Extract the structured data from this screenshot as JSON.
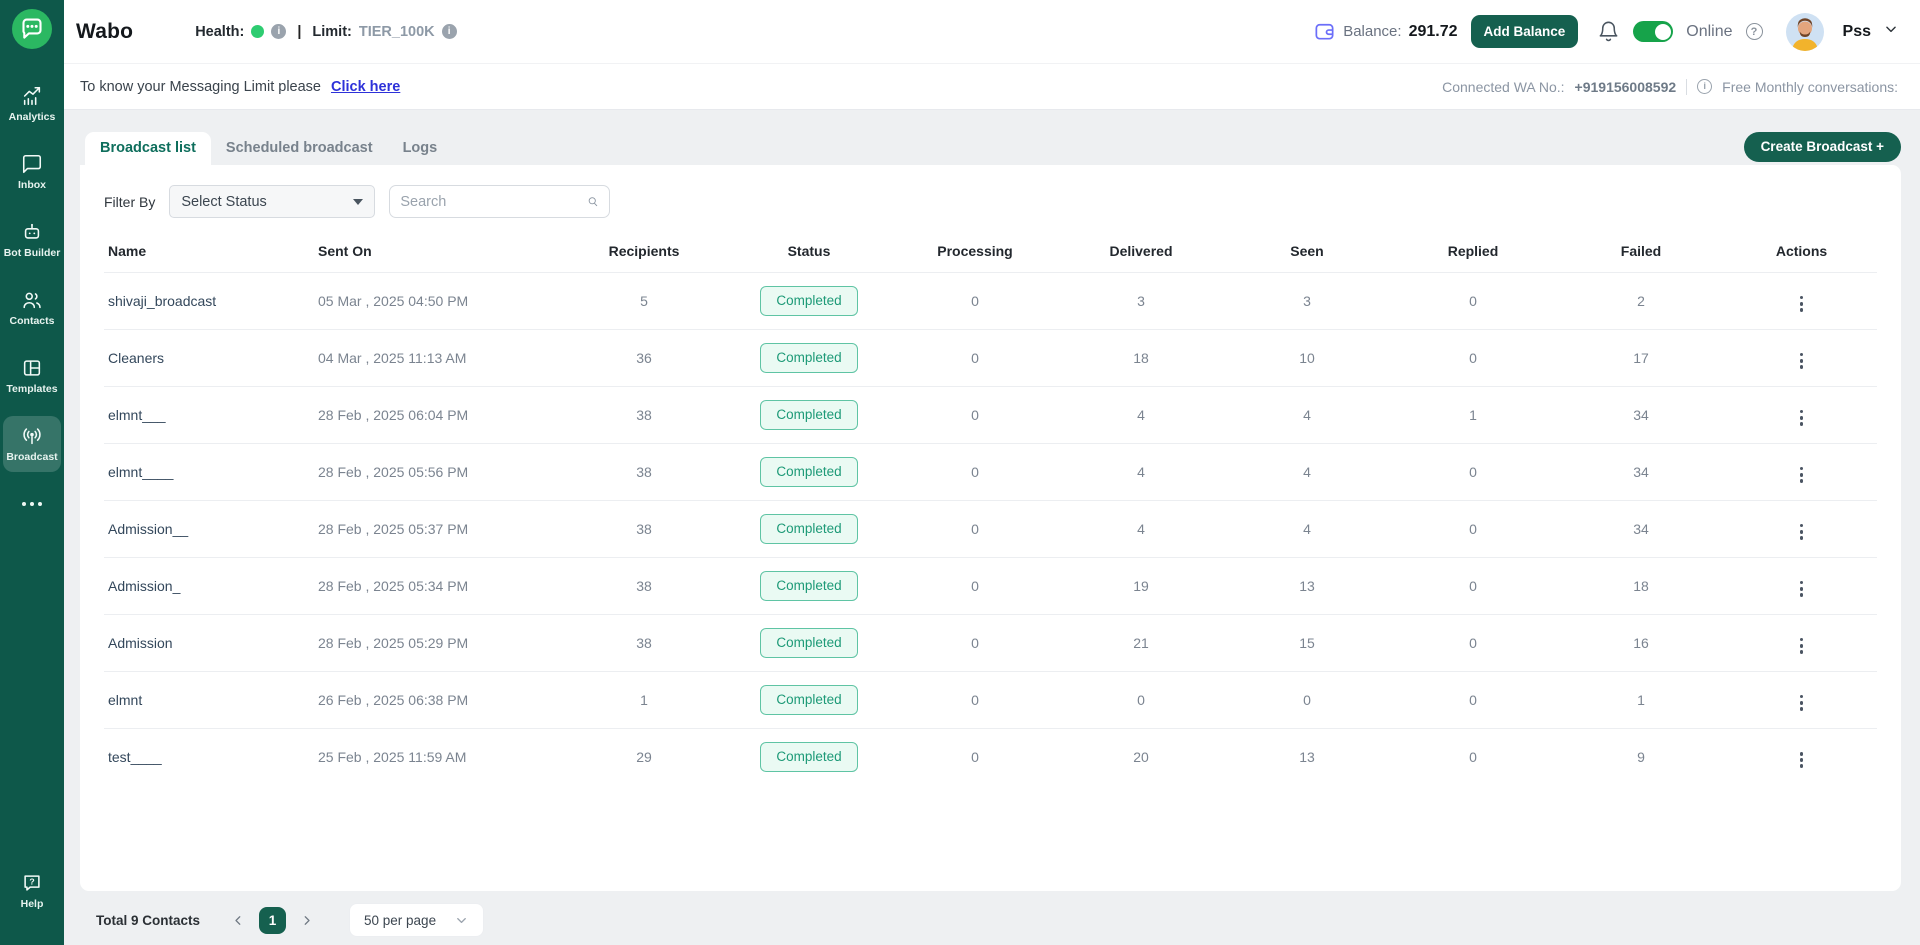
{
  "brand": {
    "name": "Wabo"
  },
  "header": {
    "health_label": "Health:",
    "limit_label": "Limit:",
    "limit_value": "TIER_100K",
    "balance_label": "Balance:",
    "balance_value": "291.72",
    "add_balance_label": "Add Balance",
    "online_label": "Online",
    "user_name": "Pss"
  },
  "notice": {
    "text": "To know your Messaging Limit please",
    "link_label": "Click here",
    "connected_label": "Connected WA No.:",
    "connected_number": "+919156008592",
    "free_conversations_label": "Free Monthly conversations:"
  },
  "tabs": [
    {
      "label": "Broadcast list",
      "active": true
    },
    {
      "label": "Scheduled broadcast",
      "active": false
    },
    {
      "label": "Logs",
      "active": false
    }
  ],
  "create_broadcast_label": "Create Broadcast +",
  "filters": {
    "filter_by_label": "Filter By",
    "status_selected": "Select Status",
    "search_placeholder": "Search"
  },
  "table": {
    "columns": [
      "Name",
      "Sent On",
      "Recipients",
      "Status",
      "Processing",
      "Delivered",
      "Seen",
      "Replied",
      "Failed",
      "Actions"
    ],
    "rows": [
      {
        "name": "shivaji_broadcast",
        "sent_on": "05 Mar , 2025 04:50 PM",
        "recipients": "5",
        "status": "Completed",
        "processing": "0",
        "delivered": "3",
        "seen": "3",
        "replied": "0",
        "failed": "2"
      },
      {
        "name": "Cleaners",
        "sent_on": "04 Mar , 2025 11:13 AM",
        "recipients": "36",
        "status": "Completed",
        "processing": "0",
        "delivered": "18",
        "seen": "10",
        "replied": "0",
        "failed": "17"
      },
      {
        "name": "elmnt___",
        "sent_on": "28 Feb , 2025 06:04 PM",
        "recipients": "38",
        "status": "Completed",
        "processing": "0",
        "delivered": "4",
        "seen": "4",
        "replied": "1",
        "failed": "34"
      },
      {
        "name": "elmnt____",
        "sent_on": "28 Feb , 2025 05:56 PM",
        "recipients": "38",
        "status": "Completed",
        "processing": "0",
        "delivered": "4",
        "seen": "4",
        "replied": "0",
        "failed": "34"
      },
      {
        "name": "Admission__",
        "sent_on": "28 Feb , 2025 05:37 PM",
        "recipients": "38",
        "status": "Completed",
        "processing": "0",
        "delivered": "4",
        "seen": "4",
        "replied": "0",
        "failed": "34"
      },
      {
        "name": "Admission_",
        "sent_on": "28 Feb , 2025 05:34 PM",
        "recipients": "38",
        "status": "Completed",
        "processing": "0",
        "delivered": "19",
        "seen": "13",
        "replied": "0",
        "failed": "18"
      },
      {
        "name": "Admission",
        "sent_on": "28 Feb , 2025 05:29 PM",
        "recipients": "38",
        "status": "Completed",
        "processing": "0",
        "delivered": "21",
        "seen": "15",
        "replied": "0",
        "failed": "16"
      },
      {
        "name": "elmnt",
        "sent_on": "26 Feb , 2025 06:38 PM",
        "recipients": "1",
        "status": "Completed",
        "processing": "0",
        "delivered": "0",
        "seen": "0",
        "replied": "0",
        "failed": "1"
      },
      {
        "name": "test____",
        "sent_on": "25 Feb , 2025 11:59 AM",
        "recipients": "29",
        "status": "Completed",
        "processing": "0",
        "delivered": "20",
        "seen": "13",
        "replied": "0",
        "failed": "9"
      }
    ]
  },
  "pagination": {
    "total_label": "Total 9 Contacts",
    "current_page": "1",
    "per_page_label": "50 per page"
  },
  "sidebar": {
    "items": [
      {
        "label": "Analytics",
        "icon": "analytics-icon",
        "active": false
      },
      {
        "label": "Inbox",
        "icon": "inbox-icon",
        "active": false
      },
      {
        "label": "Bot Builder",
        "icon": "bot-builder-icon",
        "active": false
      },
      {
        "label": "Contacts",
        "icon": "contacts-icon",
        "active": false
      },
      {
        "label": "Templates",
        "icon": "templates-icon",
        "active": false
      },
      {
        "label": "Broadcast",
        "icon": "broadcast-icon",
        "active": true
      }
    ],
    "help_label": "Help"
  },
  "colors": {
    "sidebar_bg": "#0e584a",
    "accent_teal": "#15604f",
    "logo_green": "#2bb862",
    "health_green": "#2ecc71",
    "toggle_green": "#16a34a",
    "link_blue": "#2d31d9",
    "wallet_indigo": "#6b6ef9",
    "badge_bg": "#eafaf3",
    "badge_border": "#5fc4a4",
    "badge_text": "#1d9a77",
    "page_bg": "#eef0f2"
  }
}
